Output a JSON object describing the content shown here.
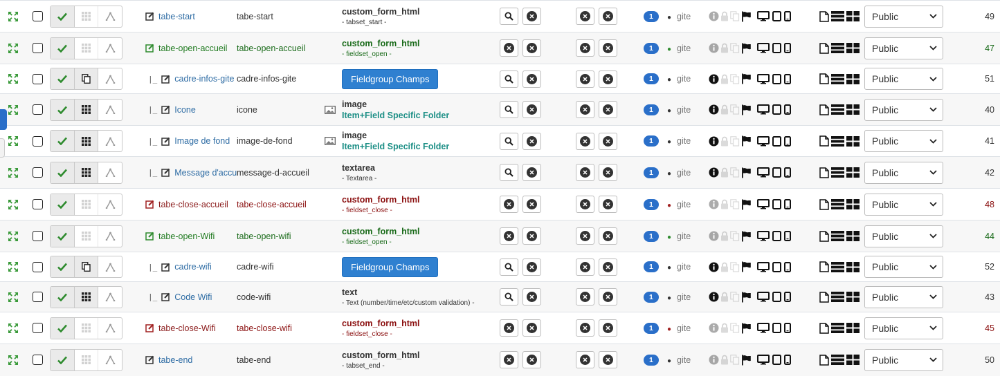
{
  "rows": [
    {
      "name": "tabe-start",
      "alias": "tabe-start",
      "kind": "html",
      "type": "custom_form_html",
      "sub": "- tabset_start -",
      "child": false,
      "color": "default",
      "btn1": "search",
      "grp": "dim",
      "extra": "dim-info",
      "icon2": "grid-icon",
      "imgIcon": false,
      "access": "Public",
      "id": "49"
    },
    {
      "name": "tabe-open-accueil",
      "alias": "tabe-open-accueil",
      "kind": "html",
      "type": "custom_form_html",
      "sub": "- fieldset_open -",
      "child": false,
      "color": "green",
      "btn1": "x",
      "grp": "dim",
      "extra": "dim-info",
      "icon2": "grid-icon",
      "imgIcon": false,
      "access": "Public",
      "id": "47"
    },
    {
      "name": "cadre-infos-gite",
      "alias": "cadre-infos-gite",
      "kind": "fieldgroup",
      "type": "Fieldgroup Champs",
      "sub": "",
      "child": true,
      "color": "default",
      "btn1": "search",
      "grp": "copy",
      "extra": "info",
      "icon2": "copy-icon",
      "imgIcon": false,
      "access": "Public",
      "id": "51"
    },
    {
      "name": "Icone",
      "alias": "icone",
      "kind": "image",
      "type": "image",
      "sub": "Item+Field Specific Folder",
      "child": true,
      "color": "default",
      "btn1": "search",
      "grp": "grid",
      "extra": "info",
      "icon2": "grid-icon",
      "imgIcon": true,
      "access": "Public",
      "id": "40"
    },
    {
      "name": "Image de fond",
      "alias": "image-de-fond",
      "kind": "image",
      "type": "image",
      "sub": "Item+Field Specific Folder",
      "child": true,
      "color": "default",
      "btn1": "search",
      "grp": "grid",
      "extra": "info",
      "icon2": "grid-icon",
      "imgIcon": true,
      "access": "Public",
      "id": "41"
    },
    {
      "name": "Message d'accueil",
      "alias": "message-d-accueil",
      "kind": "field",
      "type": "textarea",
      "sub": "- Textarea -",
      "child": true,
      "color": "default",
      "btn1": "search",
      "grp": "grid",
      "extra": "info",
      "icon2": "grid-icon",
      "imgIcon": false,
      "access": "Public",
      "id": "42"
    },
    {
      "name": "tabe-close-accueil",
      "alias": "tabe-close-accueil",
      "kind": "html",
      "type": "custom_form_html",
      "sub": "- fieldset_close -",
      "child": false,
      "color": "red",
      "btn1": "x",
      "grp": "dim",
      "extra": "dim-info",
      "icon2": "grid-icon",
      "imgIcon": false,
      "access": "Public",
      "id": "48"
    },
    {
      "name": "tabe-open-Wifi",
      "alias": "tabe-open-wifi",
      "kind": "html",
      "type": "custom_form_html",
      "sub": "- fieldset_open -",
      "child": false,
      "color": "green",
      "btn1": "x",
      "grp": "dim",
      "extra": "dim-info",
      "icon2": "grid-icon",
      "imgIcon": false,
      "access": "Public",
      "id": "44"
    },
    {
      "name": "cadre-wifi",
      "alias": "cadre-wifi",
      "kind": "fieldgroup",
      "type": "Fieldgroup Champs",
      "sub": "",
      "child": true,
      "color": "default",
      "btn1": "search",
      "grp": "copy",
      "extra": "info",
      "icon2": "copy-icon",
      "imgIcon": false,
      "access": "Public",
      "id": "52"
    },
    {
      "name": "Code Wifi",
      "alias": "code-wifi",
      "kind": "field",
      "type": "text",
      "sub": "- Text (number/time/etc/custom validation) -",
      "child": true,
      "color": "default",
      "btn1": "search",
      "grp": "grid",
      "extra": "info",
      "icon2": "grid-icon",
      "imgIcon": false,
      "access": "Public",
      "id": "43"
    },
    {
      "name": "tabe-close-Wifi",
      "alias": "tabe-close-wifi",
      "kind": "html",
      "type": "custom_form_html",
      "sub": "- fieldset_close -",
      "child": false,
      "color": "red",
      "btn1": "x",
      "grp": "dim",
      "extra": "dim-info",
      "icon2": "grid-icon",
      "imgIcon": false,
      "access": "Public",
      "id": "45"
    },
    {
      "name": "tabe-end",
      "alias": "tabe-end",
      "kind": "html",
      "type": "custom_form_html",
      "sub": "- tabset_end -",
      "child": false,
      "color": "default",
      "btn1": "x",
      "grp": "dim",
      "extra": "dim-info",
      "icon2": "grid-icon",
      "imgIcon": false,
      "access": "Public",
      "id": "50"
    }
  ],
  "badge_value": "1",
  "category_label": "gite",
  "tree_prefix": "|_",
  "colors": {
    "accent": "#2a6fc9",
    "green": "#1a6b1a",
    "red": "#8b1010",
    "folder": "#1d8f86",
    "button": "#2f80d0"
  }
}
